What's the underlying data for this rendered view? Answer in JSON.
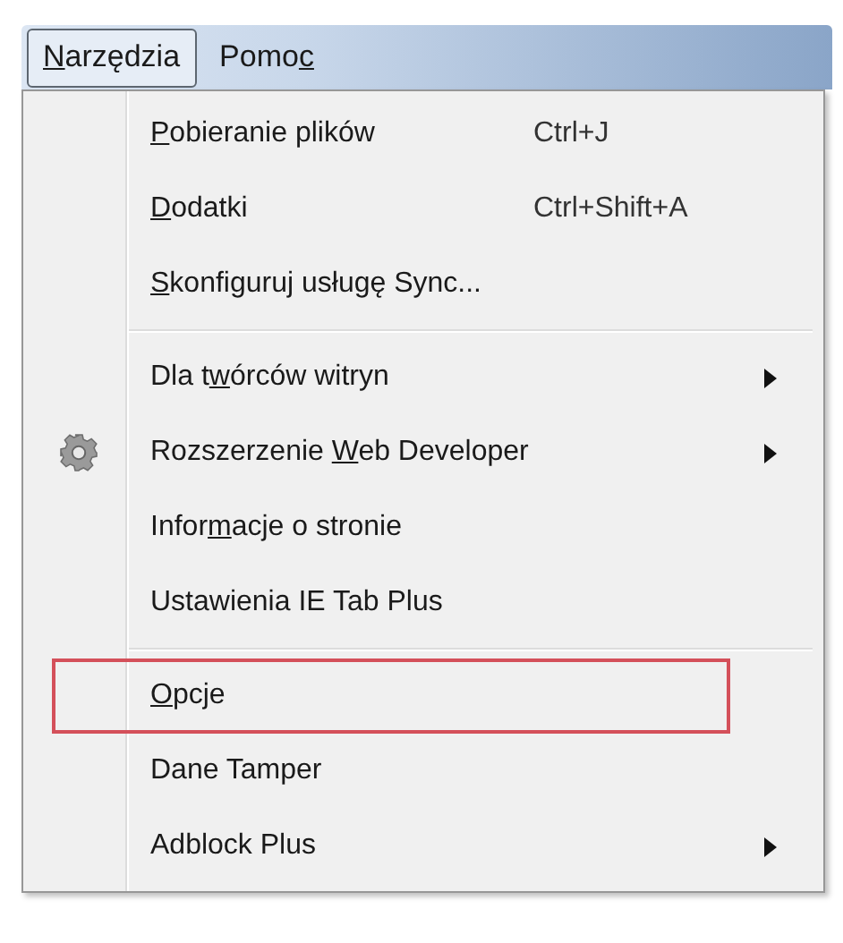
{
  "menu_bar": [
    {
      "access_key": "N",
      "after": "arzędzia",
      "selected": true
    },
    {
      "before": "Pomo",
      "access_key": "c",
      "selected": false
    }
  ],
  "menu": {
    "groups": [
      {
        "items": [
          {
            "kind": "plain",
            "access_key": "P",
            "after": "obieranie plików",
            "shortcut": "Ctrl+J",
            "submenu": false,
            "highlighted": false
          },
          {
            "kind": "plain",
            "access_key": "D",
            "after": "odatki",
            "shortcut": "Ctrl+Shift+A",
            "submenu": false,
            "highlighted": false
          },
          {
            "kind": "plain",
            "access_key": "S",
            "after": "konfiguruj usługę Sync...",
            "submenu": false,
            "highlighted": false
          }
        ]
      },
      {
        "items": [
          {
            "kind": "plain",
            "before": "Dla t",
            "access_key": "w",
            "after": "órców witryn",
            "submenu": true,
            "highlighted": false
          },
          {
            "kind": "gear",
            "before": "Rozszerzenie ",
            "access_key": "W",
            "after": "eb Developer",
            "submenu": true,
            "highlighted": false
          },
          {
            "kind": "plain",
            "before": "Infor",
            "access_key": "m",
            "after": "acje o stronie",
            "submenu": false,
            "highlighted": false
          },
          {
            "kind": "plain",
            "before": "Ustawienia IE Tab Plus",
            "submenu": false,
            "highlighted": false
          }
        ]
      },
      {
        "items": [
          {
            "kind": "plain",
            "access_key": "O",
            "after": "pcje",
            "submenu": false,
            "highlighted": true
          },
          {
            "kind": "plain",
            "before": "Dane Tamper",
            "submenu": false,
            "highlighted": false
          },
          {
            "kind": "plain",
            "before": "Adblock Plus",
            "submenu": true,
            "highlighted": false
          }
        ]
      }
    ]
  }
}
